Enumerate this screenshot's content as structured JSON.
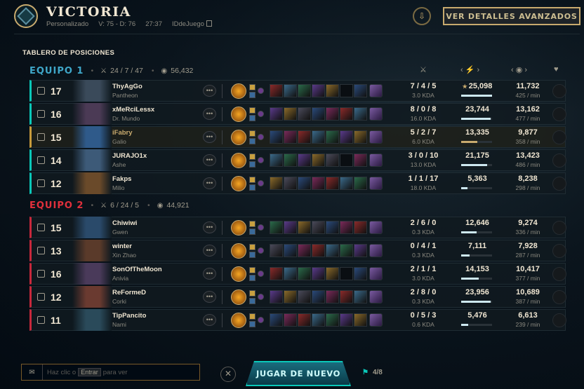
{
  "header": {
    "title": "VICTORIA",
    "mode": "Personalizado",
    "votes_summary": "V: 75 - D: 76",
    "duration": "27:37",
    "game_id_label": "IDdeJuego",
    "advanced_button": "VER DETALLES AVANZADOS"
  },
  "board_title": "TABLERO DE POSICIONES",
  "teams": [
    {
      "name": "EQUIPO 1",
      "kda": "24 / 7 / 47",
      "gold": "56,432",
      "players": [
        {
          "level": "17",
          "name": "ThyAgGo",
          "champion": "Pantheon",
          "kda": "7 / 4 / 5",
          "kda_ratio": "3.0 KDA",
          "damage": "25,098",
          "damage_fraction": 1.0,
          "gold": "11,732",
          "gpm": "425 / min",
          "color": "#3a4a5a"
        },
        {
          "level": "16",
          "name": "xMeRciLessx",
          "champion": "Dr. Mundo",
          "kda": "8 / 0 / 8",
          "kda_ratio": "16.0 KDA",
          "damage": "23,744",
          "damage_fraction": 0.95,
          "gold": "13,162",
          "gpm": "477 / min",
          "color": "#4b3a55"
        },
        {
          "level": "15",
          "name": "iFabry",
          "champion": "Galio",
          "kda": "5 / 2 / 7",
          "kda_ratio": "6.0 KDA",
          "damage": "13,335",
          "damage_fraction": 0.53,
          "gold": "9,877",
          "gpm": "358 / min",
          "color": "#2f5a8a"
        },
        {
          "level": "14",
          "name": "JURAJO1x",
          "champion": "Ashe",
          "kda": "3 / 0 / 10",
          "kda_ratio": "13.0 KDA",
          "damage": "21,175",
          "damage_fraction": 0.84,
          "gold": "13,423",
          "gpm": "486 / min",
          "color": "#3d5a78"
        },
        {
          "level": "12",
          "name": "Fakps",
          "champion": "Milio",
          "kda": "1 / 1 / 17",
          "kda_ratio": "18.0 KDA",
          "damage": "5,363",
          "damage_fraction": 0.21,
          "gold": "8,238",
          "gpm": "298 / min",
          "color": "#6a4a2a"
        }
      ]
    },
    {
      "name": "EQUIPO 2",
      "kda": "6 / 24 / 5",
      "gold": "44,921",
      "players": [
        {
          "level": "15",
          "name": "Chiwiwi",
          "champion": "Gwen",
          "kda": "2 / 6 / 0",
          "kda_ratio": "0.3 KDA",
          "damage": "12,646",
          "damage_fraction": 0.5,
          "gold": "9,274",
          "gpm": "336 / min",
          "color": "#2a4a6a"
        },
        {
          "level": "13",
          "name": "winter",
          "champion": "Xin Zhao",
          "kda": "0 / 4 / 1",
          "kda_ratio": "0.3 KDA",
          "damage": "7,111",
          "damage_fraction": 0.28,
          "gold": "7,928",
          "gpm": "287 / min",
          "color": "#5a3a2a"
        },
        {
          "level": "16",
          "name": "SonOfTheMoon",
          "champion": "Anivia",
          "kda": "2 / 1 / 1",
          "kda_ratio": "3.0 KDA",
          "damage": "14,153",
          "damage_fraction": 0.56,
          "gold": "10,417",
          "gpm": "377 / min",
          "color": "#4a3a5a"
        },
        {
          "level": "12",
          "name": "ReFormeD",
          "champion": "Corki",
          "kda": "2 / 8 / 0",
          "kda_ratio": "0.3 KDA",
          "damage": "23,956",
          "damage_fraction": 0.95,
          "gold": "10,689",
          "gpm": "387 / min",
          "color": "#6a3a30"
        },
        {
          "level": "11",
          "name": "TipPancito",
          "champion": "Nami",
          "kda": "0 / 5 / 3",
          "kda_ratio": "0.6 KDA",
          "damage": "5,476",
          "damage_fraction": 0.22,
          "gold": "6,613",
          "gpm": "239 / min",
          "color": "#2a4a5a"
        }
      ]
    }
  ],
  "item_palette": [
    "#8a2a2a",
    "#3a6a8a",
    "#2a6a4a",
    "#5a3a8a",
    "#8a6a2a",
    "#4a4a5a",
    "#2a4a7a",
    "#7a2a5a"
  ],
  "chat": {
    "hint_before": "Haz clic o",
    "hint_key": "Entrar",
    "hint_after": "para ver"
  },
  "play_again": "JUGAR DE NUEVO",
  "votes": "4/8"
}
